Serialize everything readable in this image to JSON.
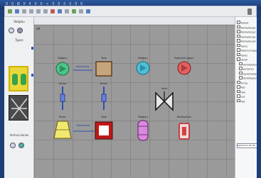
{
  "titlebar": {
    "title": "0 · 0 · Ø · 0 · 4 · 0 · 0 · < · 0 · 0 · 0 · 0 · 0 · 0 ·"
  },
  "left_panel": {
    "section1": "Rotglau",
    "section2": "Types",
    "section3": "Instrucciones"
  },
  "canvas": {
    "corner_label": "Alt",
    "symbols": [
      {
        "label": "Rotglau",
        "icon": "green-pump-icon"
      },
      {
        "label": "Tank",
        "icon": "tan-tank-icon"
      },
      {
        "label": "Rotglau",
        "icon": "cyan-pump-icon"
      },
      {
        "label": "Rotenschuppen",
        "icon": "red-pump-icon"
      },
      {
        "label": "Sensor",
        "icon": "blue-sensor-icon"
      },
      {
        "label": "Sensor",
        "icon": "blue-sensor-icon"
      },
      {
        "label": "Valve",
        "icon": "gate-valve-icon"
      },
      {
        "label": "Mixer",
        "icon": "yellow-mixer-icon"
      },
      {
        "label": "Tank",
        "icon": "red-boiler-icon"
      },
      {
        "label": "Rotglau",
        "icon": "purple-vessel-icon"
      },
      {
        "label": "Tanksystem",
        "icon": "red-tank-icon"
      }
    ],
    "connectors": [
      {
        "label": "Rohrleitung"
      },
      {
        "label": "Rohrleitung"
      }
    ]
  },
  "right_panel": {
    "items": [
      "Tanpot",
      "Rohrleitung1",
      "Rohrleitung2",
      "Rohrleitung3",
      "Rohrleitung4",
      "Tank1",
      "Rotenschuppen",
      "Tank2",
      "Ventil",
      "Ventilkasten",
      "Sensoren",
      "Sensorkabel",
      "Ventilkasten2",
      "Pump",
      "Ped",
      "Hall",
      "Led",
      "Ped"
    ],
    "input_value": "Speichern P1.00"
  },
  "colors": {
    "frame": "#1d3f78",
    "canvas_bg": "#9a9a9a",
    "grid": "#787878",
    "accent_yellow": "#e8d83a"
  }
}
